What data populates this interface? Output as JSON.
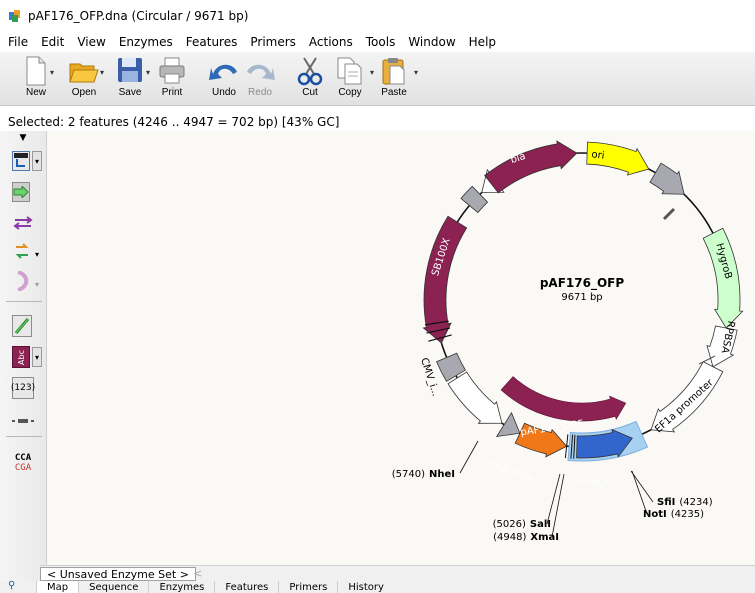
{
  "window": {
    "title": "pAF176_OFP.dna  (Circular / 9671 bp)"
  },
  "menu": [
    "File",
    "Edit",
    "View",
    "Enzymes",
    "Features",
    "Primers",
    "Actions",
    "Tools",
    "Window",
    "Help"
  ],
  "toolbar": {
    "new": "New",
    "open": "Open",
    "save": "Save",
    "print": "Print",
    "undo": "Undo",
    "redo": "Redo",
    "cut": "Cut",
    "copy": "Copy",
    "paste": "Paste"
  },
  "status": {
    "selection": "Selected:  2 features  (4246 .. 4947  =  702 bp)     [43% GC]"
  },
  "left_tools": {
    "abc": "Abc",
    "count": "(123)",
    "cca": "CCA",
    "cga": "CGA"
  },
  "map": {
    "name": "pAF176_OFP",
    "length": "9671 bp",
    "features": {
      "ori": "ori",
      "bla": "bla",
      "hygro": "HygroB",
      "rpbsa": "RPBSA",
      "ef1a": "EF1a promoter",
      "sb100x": "SB100X",
      "cmv": "CMV_i...",
      "orf": "pAF176_ORF",
      "morange": "mOrange",
      "saha": "saha_C..."
    },
    "sites": {
      "nhei_pos": "(5740)",
      "nhei": "NheI",
      "sali_pos": "(5026)",
      "sali": "SalI",
      "xmai_pos": "(4948)",
      "xmai": "XmaI",
      "sfii": "SfiI",
      "sfii_pos": "(4234)",
      "noti": "NotI",
      "noti_pos": "(4235)"
    }
  },
  "enzyme_set": {
    "label": "< Unsaved Enzyme Set >",
    "arrow": "<"
  },
  "tabs": [
    "Map",
    "Sequence",
    "Enzymes",
    "Features",
    "Primers",
    "History"
  ],
  "colors": {
    "maroon": "#8b2252",
    "yellow": "#ffff00",
    "lightgreen": "#ccffcc",
    "orange": "#f07818",
    "blue": "#3366cc",
    "selection": "#a8d0f0",
    "gray": "#a8a8b0"
  }
}
